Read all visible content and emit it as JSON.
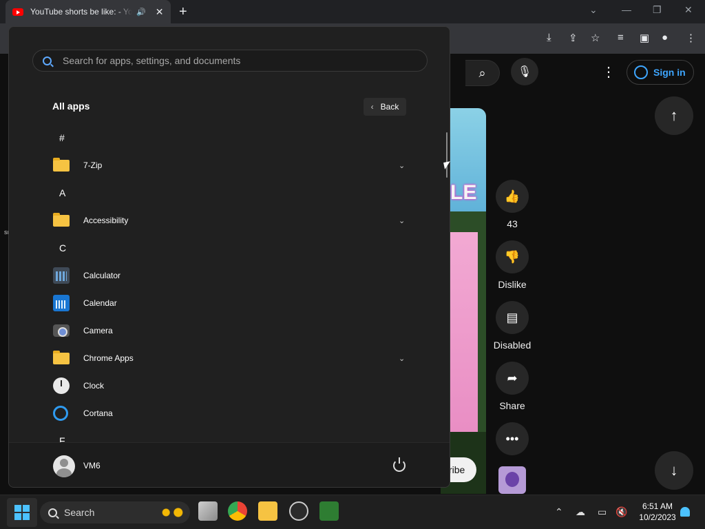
{
  "browser": {
    "tab_title": "YouTube shorts be like: - YouTube",
    "new_tab_label": "+",
    "window_controls": {
      "minimize": "—",
      "restore": "❐",
      "close": "✕",
      "tab_search": "⌄"
    }
  },
  "youtube": {
    "sign_in_label": "Sign in",
    "actions": {
      "like_count": "43",
      "dislike_label": "Dislike",
      "comments_label": "Disabled",
      "share_label": "Share"
    },
    "subscribe_partial": "ribe",
    "video_overlay_text": "LE",
    "left_edge_text": "sı"
  },
  "start_menu": {
    "search_placeholder": "Search for apps, settings, and documents",
    "all_apps_title": "All apps",
    "back_label": "Back",
    "entries": [
      {
        "type": "letter",
        "text": "#"
      },
      {
        "type": "app",
        "name": "7-Zip",
        "icon": "folder-icon",
        "expandable": true
      },
      {
        "type": "letter",
        "text": "A"
      },
      {
        "type": "app",
        "name": "Accessibility",
        "icon": "folder-icon",
        "expandable": true
      },
      {
        "type": "letter",
        "text": "C"
      },
      {
        "type": "app",
        "name": "Calculator",
        "icon": "calculator-icon",
        "expandable": false
      },
      {
        "type": "app",
        "name": "Calendar",
        "icon": "calendar-icon",
        "expandable": false
      },
      {
        "type": "app",
        "name": "Camera",
        "icon": "camera-icon",
        "expandable": false
      },
      {
        "type": "app",
        "name": "Chrome Apps",
        "icon": "folder-icon",
        "expandable": true
      },
      {
        "type": "app",
        "name": "Clock",
        "icon": "clock-icon",
        "expandable": false
      },
      {
        "type": "app",
        "name": "Cortana",
        "icon": "cortana-icon",
        "expandable": false
      },
      {
        "type": "letter",
        "text": "F"
      }
    ],
    "user_name": "VM6"
  },
  "taskbar": {
    "search_label": "Search",
    "time": "6:51 AM",
    "date": "10/2/2023"
  },
  "colors": {
    "accent": "#4cc2ff",
    "youtube_red": "#ff0000",
    "signin_blue": "#3ea6ff"
  }
}
